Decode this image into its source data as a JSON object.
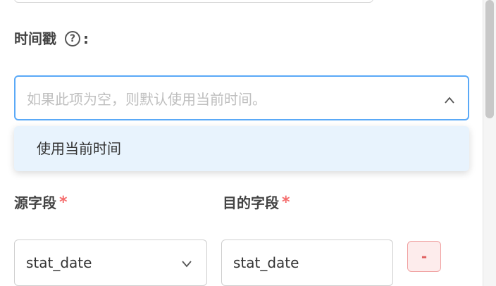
{
  "timestamp": {
    "label": "时间戳",
    "help_icon": "?",
    "colon": ":",
    "placeholder": "如果此项为空，则默认使用当前时间。",
    "dropdown_options": [
      "使用当前时间"
    ]
  },
  "mapping": {
    "source_label": "源字段",
    "target_label": "目的字段",
    "required_mark": "*",
    "source_value": "stat_date",
    "target_value": "stat_date",
    "remove_label": "-"
  },
  "colors": {
    "focus_border": "#5aa9f7",
    "dropdown_bg": "#e8f3fd",
    "required": "#f56c6c",
    "remove_button": "#e06060"
  }
}
